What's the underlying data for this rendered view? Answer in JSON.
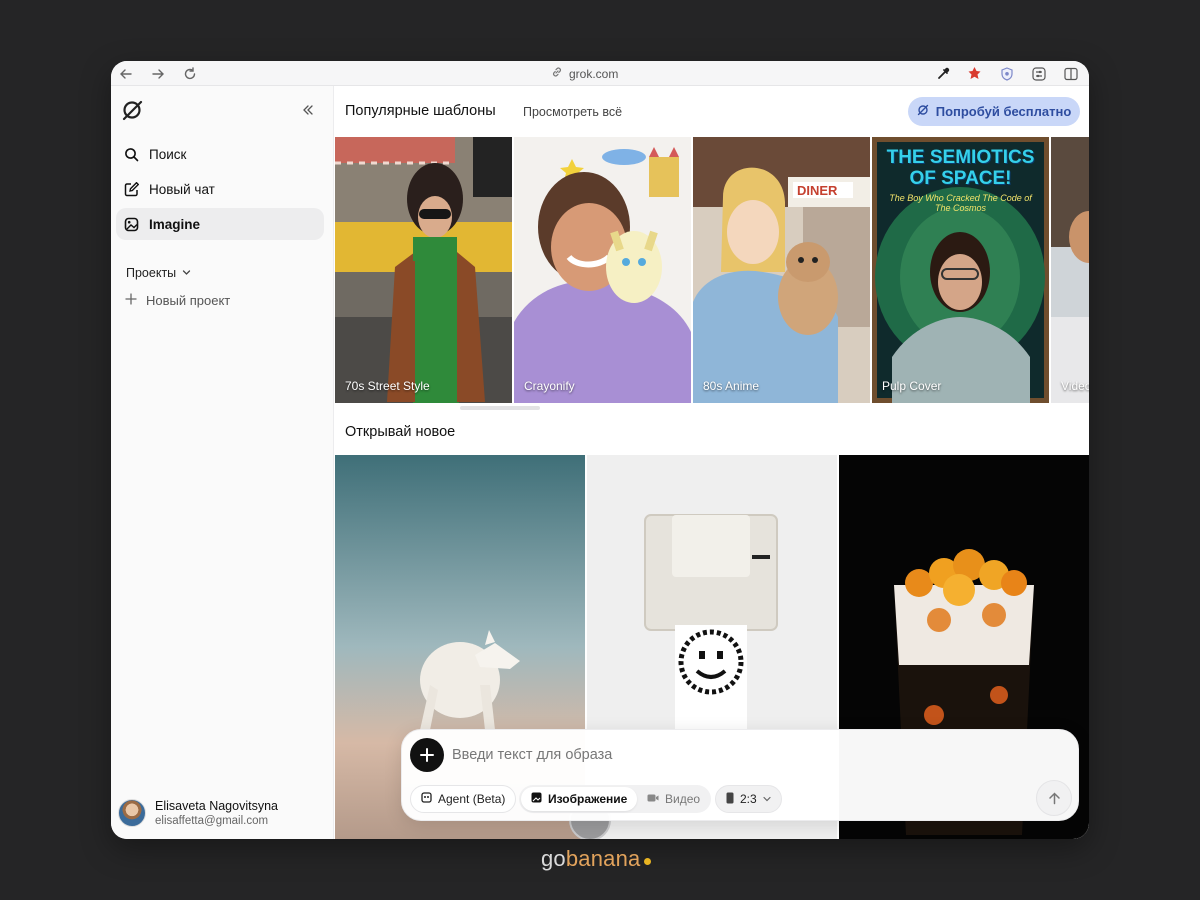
{
  "browser": {
    "url": "grok.com",
    "back_icon": "arrow-left-icon",
    "forward_icon": "arrow-right-icon",
    "reload_icon": "reload-icon",
    "extensions": [
      "eyedropper-icon",
      "extension-red-icon",
      "shield-icon",
      "sliders-icon",
      "sidebar-icon"
    ]
  },
  "sidebar": {
    "items": [
      {
        "label": "Поиск",
        "icon": "search-icon"
      },
      {
        "label": "Новый чат",
        "icon": "edit-icon"
      },
      {
        "label": "Imagine",
        "icon": "image-icon",
        "active": true
      }
    ],
    "projects_label": "Проекты",
    "new_project_label": "Новый проект",
    "user": {
      "name": "Elisaveta Nagovitsyna",
      "email": "elisaffetta@gmail.com"
    }
  },
  "main": {
    "popular_title": "Популярные шаблоны",
    "view_all": "Просмотреть всё",
    "try_button": "Попробуй бесплатно",
    "templates": [
      {
        "label": "70s Street Style"
      },
      {
        "label": "Crayonify"
      },
      {
        "label": "80s Anime"
      },
      {
        "label": "Pulp Cover",
        "cover_title": "THE SEMIOTICS OF SPACE!",
        "cover_subtitle": "The Boy Who Cracked The Code of The Cosmos"
      },
      {
        "label": "Video"
      }
    ],
    "discover_title": "Открывай новое"
  },
  "prompt": {
    "placeholder": "Введи текст для образа",
    "agent_label": "Agent (Beta)",
    "image_label": "Изображение",
    "video_label": "Видео",
    "ratio_label": "2:3"
  },
  "brand": {
    "go": "go",
    "banana": "banana"
  },
  "colors": {
    "accent_button_bg": "#c9d7f8",
    "accent_button_text": "#2e4da0",
    "brand_orange": "#e2a35c",
    "brand_dot": "#e8b422"
  }
}
